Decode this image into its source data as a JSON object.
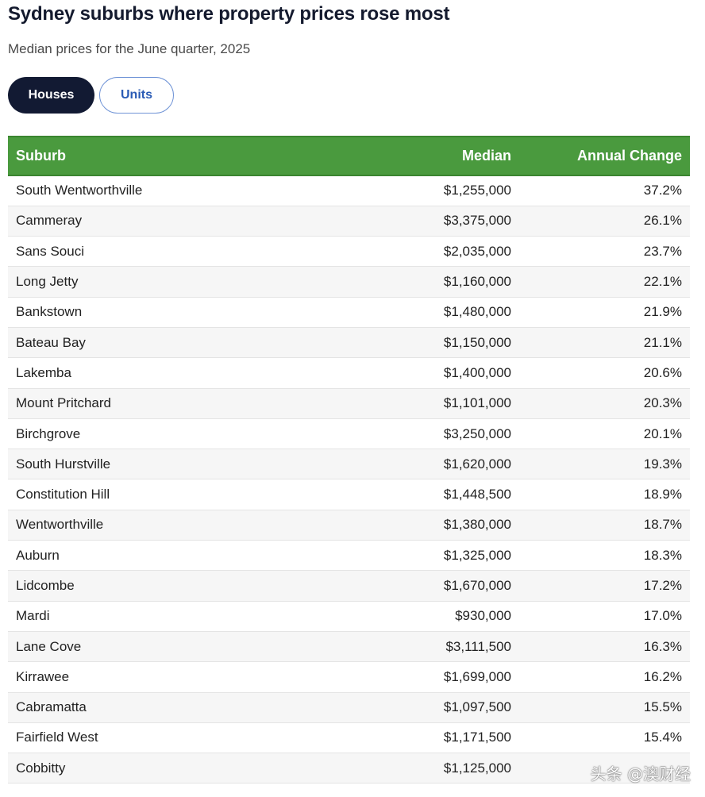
{
  "header": {
    "title": "Sydney suburbs where property prices rose most",
    "subtitle": "Median prices for the June quarter, 2025"
  },
  "tabs": [
    {
      "label": "Houses",
      "active": true
    },
    {
      "label": "Units",
      "active": false
    }
  ],
  "table": {
    "columns": [
      "Suburb",
      "Median",
      "Annual Change"
    ],
    "rows": [
      [
        "South Wentworthville",
        "$1,255,000",
        "37.2%"
      ],
      [
        "Cammeray",
        "$3,375,000",
        "26.1%"
      ],
      [
        "Sans Souci",
        "$2,035,000",
        "23.7%"
      ],
      [
        "Long Jetty",
        "$1,160,000",
        "22.1%"
      ],
      [
        "Bankstown",
        "$1,480,000",
        "21.9%"
      ],
      [
        "Bateau Bay",
        "$1,150,000",
        "21.1%"
      ],
      [
        "Lakemba",
        "$1,400,000",
        "20.6%"
      ],
      [
        "Mount Pritchard",
        "$1,101,000",
        "20.3%"
      ],
      [
        "Birchgrove",
        "$3,250,000",
        "20.1%"
      ],
      [
        "South Hurstville",
        "$1,620,000",
        "19.3%"
      ],
      [
        "Constitution Hill",
        "$1,448,500",
        "18.9%"
      ],
      [
        "Wentworthville",
        "$1,380,000",
        "18.7%"
      ],
      [
        "Auburn",
        "$1,325,000",
        "18.3%"
      ],
      [
        "Lidcombe",
        "$1,670,000",
        "17.2%"
      ],
      [
        "Mardi",
        "$930,000",
        "17.0%"
      ],
      [
        "Lane Cove",
        "$3,111,500",
        "16.3%"
      ],
      [
        "Kirrawee",
        "$1,699,000",
        "16.2%"
      ],
      [
        "Cabramatta",
        "$1,097,500",
        "15.5%"
      ],
      [
        "Fairfield West",
        "$1,171,500",
        "15.4%"
      ],
      [
        "Cobbitty",
        "$1,125,000",
        ""
      ]
    ]
  },
  "watermark": "头条 @澳财经",
  "colors": {
    "header_bg": "#4a9a3e",
    "active_tab_bg": "#121a33",
    "inactive_tab_text": "#2a5bb5",
    "title_text": "#141a2e"
  }
}
